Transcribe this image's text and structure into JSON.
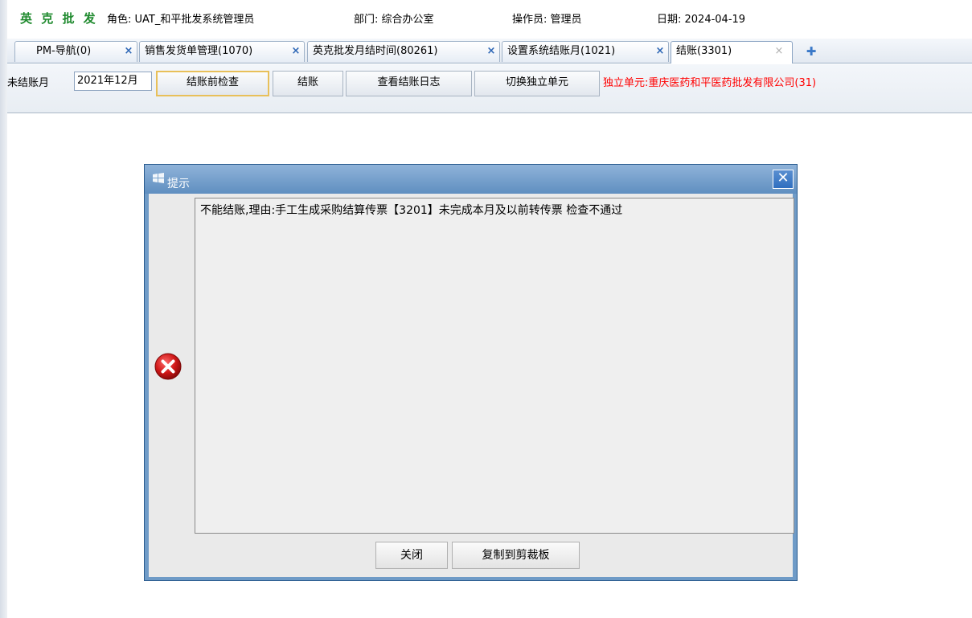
{
  "header": {
    "brand": "英 克 批 发",
    "role": "角色: UAT_和平批发系统管理员",
    "department": "部门: 综合办公室",
    "operator": "操作员: 管理员",
    "date": "日期: 2024-04-19"
  },
  "tabs": [
    {
      "label": "PM-导航(0)",
      "active": false
    },
    {
      "label": "销售发货单管理(1070)",
      "active": false
    },
    {
      "label": "英克批发月结时间(80261)",
      "active": false
    },
    {
      "label": "设置系统结账月(1021)",
      "active": false
    },
    {
      "label": "结账(3301)",
      "active": true
    }
  ],
  "toolbar": {
    "unsettled_label": "未结账月",
    "unsettled_value": "2021年12月",
    "pre_check_label": "结账前检查",
    "settle_label": "结账",
    "view_log_label": "查看结账日志",
    "switch_unit_label": "切换独立单元",
    "unit_info": "独立单元:重庆医药和平医药批发有限公司(31)"
  },
  "dialog": {
    "title": "提示",
    "message": "不能结账,理由:手工生成采购结算传票【3201】未完成本月及以前转传票 检查不通过",
    "close_label": "关闭",
    "copy_label": "复制到剪裁板"
  },
  "icons": {
    "tab_close": "close-icon",
    "tab_add": "add-tab-icon",
    "dialog_close": "close-icon",
    "error": "error-icon"
  },
  "colors": {
    "brand": "#1f8a2e",
    "unit_info": "#ff0000",
    "dialog_frame": "#6f9bc7",
    "error_red": "#d01818"
  }
}
